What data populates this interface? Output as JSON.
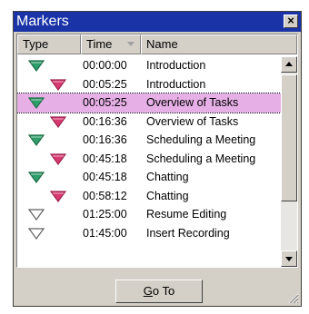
{
  "window": {
    "title": "Markers",
    "close_glyph": "×"
  },
  "table": {
    "columns": [
      {
        "label": "Type"
      },
      {
        "label": "Time"
      },
      {
        "label": "Name"
      }
    ],
    "sorted_column": "Time",
    "rows": [
      {
        "marker": "green-down-triangle-icon",
        "level": 1,
        "time": "00:00:00",
        "name": "Introduction",
        "selected": false
      },
      {
        "marker": "red-down-triangle-icon",
        "level": 2,
        "time": "00:05:25",
        "name": "Introduction",
        "selected": false
      },
      {
        "marker": "green-down-triangle-icon",
        "level": 1,
        "time": "00:05:25",
        "name": "Overview of Tasks",
        "selected": true
      },
      {
        "marker": "red-down-triangle-icon",
        "level": 2,
        "time": "00:16:36",
        "name": "Overview of Tasks",
        "selected": false
      },
      {
        "marker": "green-down-triangle-icon",
        "level": 1,
        "time": "00:16:36",
        "name": "Scheduling a Meeting",
        "selected": false
      },
      {
        "marker": "red-down-triangle-icon",
        "level": 2,
        "time": "00:45:18",
        "name": "Scheduling a Meeting",
        "selected": false
      },
      {
        "marker": "green-down-triangle-icon",
        "level": 1,
        "time": "00:45:18",
        "name": "Chatting",
        "selected": false
      },
      {
        "marker": "red-down-triangle-icon",
        "level": 2,
        "time": "00:58:12",
        "name": "Chatting",
        "selected": false
      },
      {
        "marker": "outline-down-triangle-icon",
        "level": 1,
        "time": "01:25:00",
        "name": "Resume Editing",
        "selected": false
      },
      {
        "marker": "outline-down-triangle-icon",
        "level": 1,
        "time": "01:45:00",
        "name": "Insert Recording",
        "selected": false
      }
    ]
  },
  "buttons": {
    "goto_label_prefix": "G",
    "goto_label_rest": "o To"
  },
  "colors": {
    "titlebar": "#1a34a8",
    "selection": "#e6b0e6",
    "marker_green": "#2e9e6a",
    "marker_red": "#d83a70",
    "marker_outline": "#606060"
  }
}
